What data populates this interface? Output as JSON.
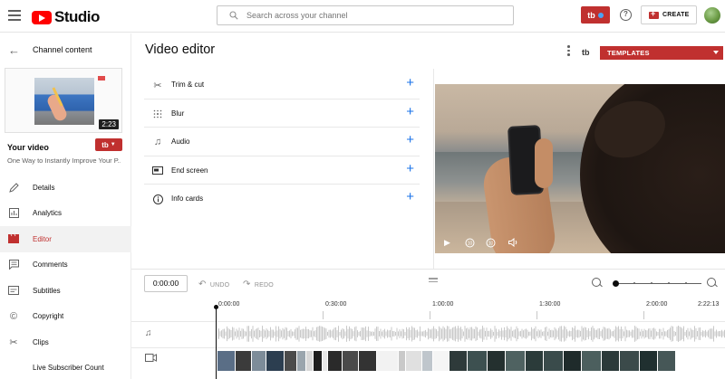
{
  "header": {
    "logo_text": "Studio",
    "search_placeholder": "Search across your channel",
    "tubebuddy_badge": "tb",
    "help_glyph": "?",
    "create_label": "CREATE"
  },
  "sidebar": {
    "back_label": "Channel content",
    "thumbnail_duration": "2:23",
    "your_video_label": "Your video",
    "video_title": "One Way to Instantly Improve Your P...",
    "tb_label": "tb",
    "items": [
      {
        "label": "Details",
        "icon": "pencil-icon"
      },
      {
        "label": "Analytics",
        "icon": "analytics-icon"
      },
      {
        "label": "Editor",
        "icon": "editor-icon",
        "active": true
      },
      {
        "label": "Comments",
        "icon": "comments-icon"
      },
      {
        "label": "Subtitles",
        "icon": "subtitles-icon"
      },
      {
        "label": "Copyright",
        "icon": "copyright-icon"
      },
      {
        "label": "Clips",
        "icon": "scissors-icon"
      },
      {
        "label": "Live Subscriber Count",
        "icon": "none"
      }
    ]
  },
  "main": {
    "title": "Video editor",
    "tb_mini": "tb",
    "templates_label": "TEMPLATES",
    "tools": [
      {
        "label": "Trim & cut",
        "icon": "scissors-icon"
      },
      {
        "label": "Blur",
        "icon": "blur-icon"
      },
      {
        "label": "Audio",
        "icon": "music-note-icon"
      },
      {
        "label": "End screen",
        "icon": "end-screen-icon"
      },
      {
        "label": "Info cards",
        "icon": "info-icon"
      }
    ]
  },
  "timeline": {
    "current_time": "0:00:00",
    "undo_label": "UNDO",
    "redo_label": "REDO",
    "ticks": [
      "0:00:00",
      "0:30:00",
      "1:00:00",
      "1:30:00",
      "2:00:00",
      "2:22:13"
    ]
  },
  "colors": {
    "brand_red": "#c0302f",
    "accent_blue": "#1a73e8"
  }
}
